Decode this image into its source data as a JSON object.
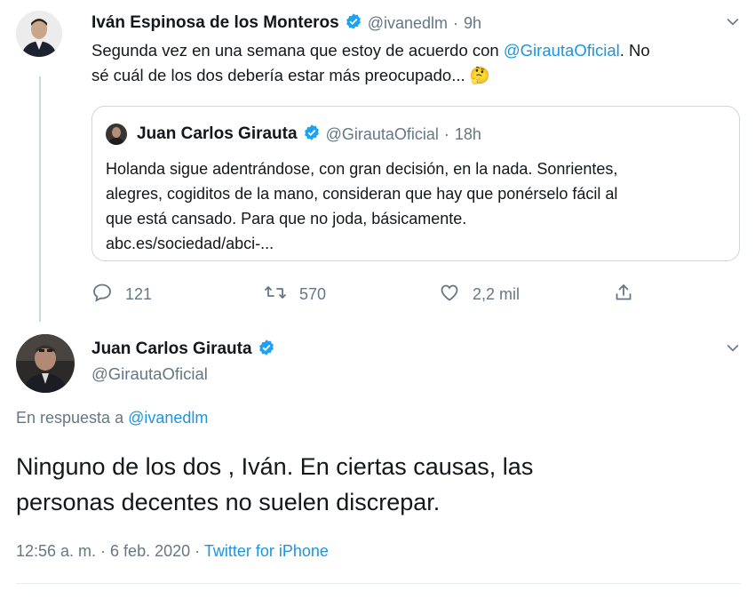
{
  "colors": {
    "link": "#1b95e0",
    "verified": "#1da1f2",
    "muted": "#657786",
    "retweet_green": "#17bf63"
  },
  "parent_tweet": {
    "author_name": "Iván Espinosa de los Monteros",
    "handle": "@ivanedlm",
    "separator": "·",
    "time": "9h",
    "text_before_mention": "Segunda vez en una semana que estoy de acuerdo con ",
    "mention": "@GirautaOficial",
    "text_line1_end": ". No",
    "text_line2": "sé cuál de los dos debería estar más preocupado... ",
    "emoji": "🤔",
    "quoted": {
      "author_name": "Juan Carlos Girauta",
      "handle": "@GirautaOficial",
      "separator": "·",
      "time": "18h",
      "lines": [
        "Holanda sigue adentrándose, con gran decisión, en la nada. Sonrientes,",
        "alegres, cogiditos de la mano, consideran que hay que ponérselo fácil al",
        "que está cansado. Para que no joda, básicamente.",
        "abc.es/sociedad/abci-..."
      ]
    },
    "actions": {
      "replies": "121",
      "retweets": "570",
      "likes": "2,2 mil"
    }
  },
  "reply_tweet": {
    "author_name": "Juan Carlos Girauta",
    "handle": "@GirautaOficial",
    "in_reply_prefix": "En respuesta a ",
    "in_reply_handle": "@ivanedlm",
    "text_lines": [
      "Ninguno de los dos , Iván. En ciertas causas, las",
      "personas decentes no suelen discrepar."
    ],
    "timestamp": "12:56 a. m. · 6 feb. 2020",
    "separator": "·",
    "source": "Twitter for iPhone"
  },
  "icons": [
    "chevron-down-icon",
    "verified-badge-icon",
    "reply-icon",
    "retweet-icon",
    "like-icon",
    "share-icon"
  ]
}
